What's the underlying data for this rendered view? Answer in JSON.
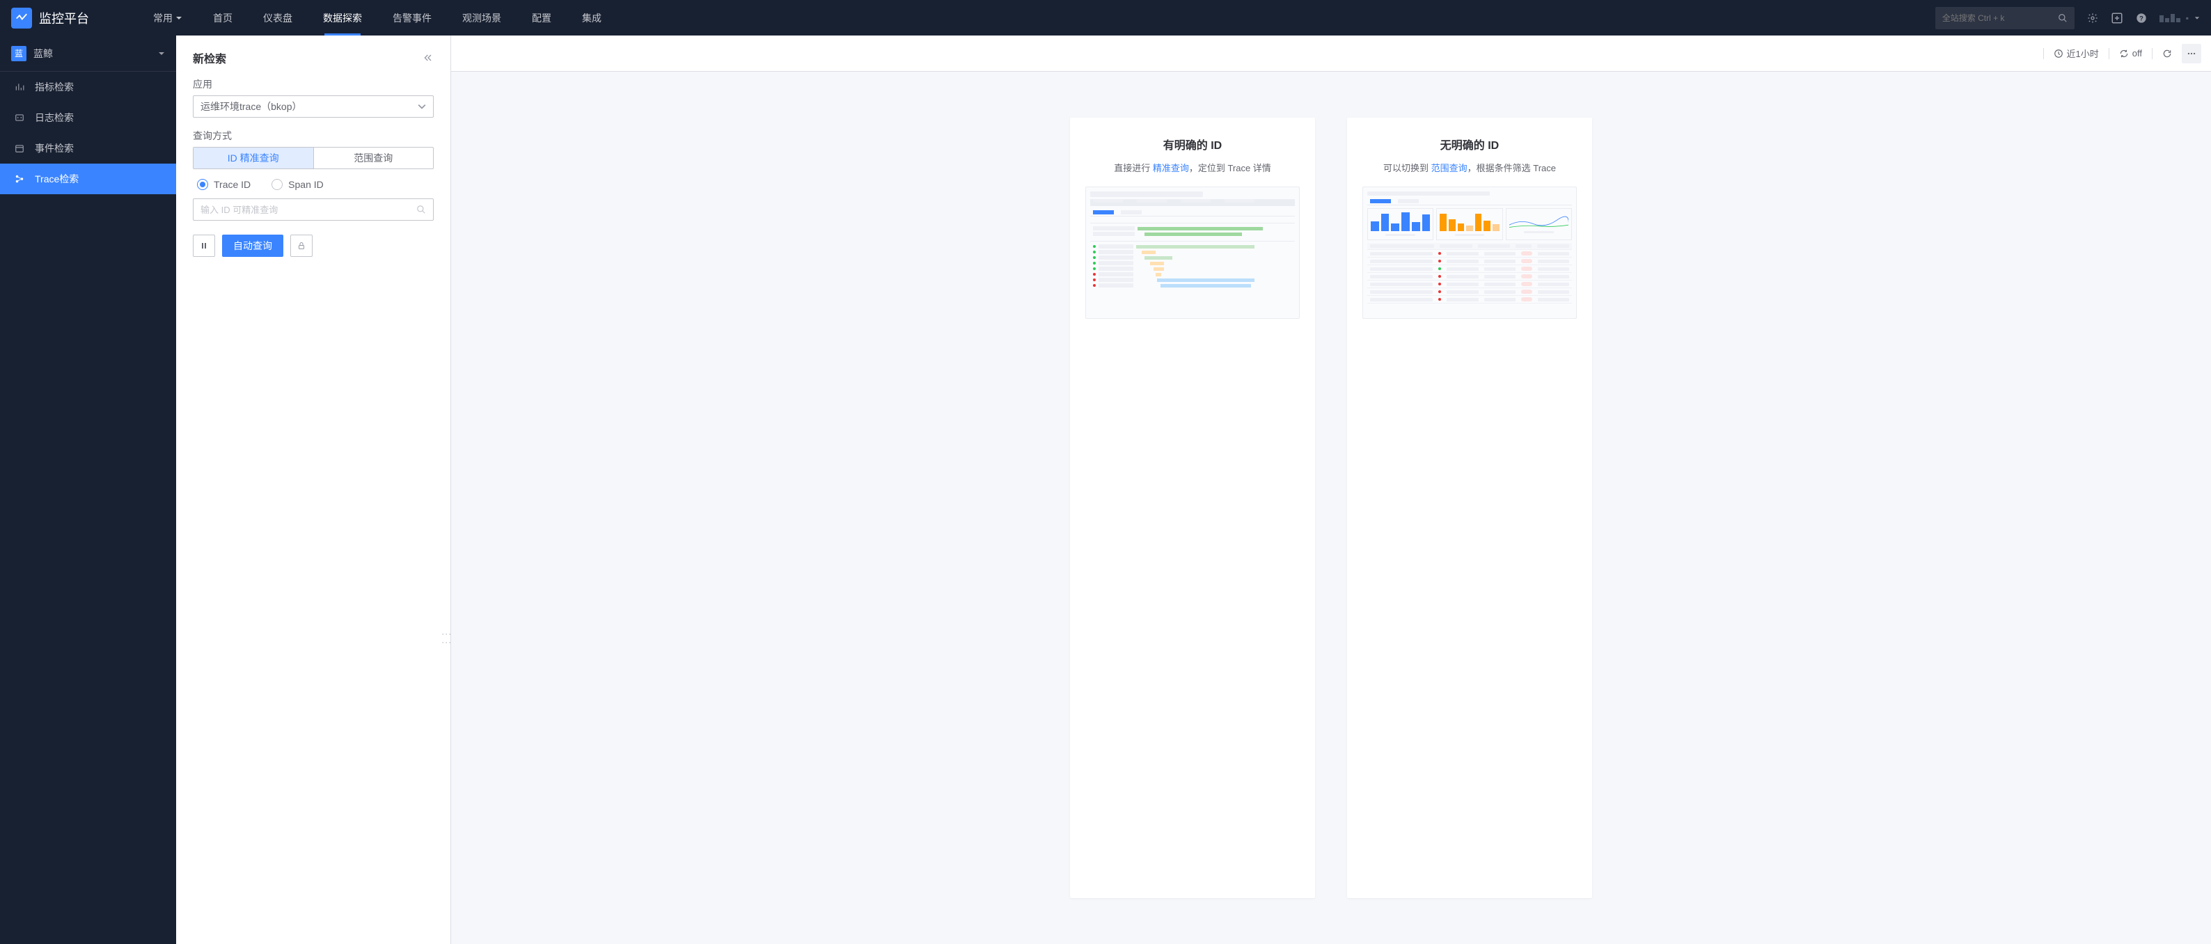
{
  "header": {
    "logo_text": "监控平台",
    "nav_dropdown": "常用",
    "nav": [
      "首页",
      "仪表盘",
      "数据探索",
      "告警事件",
      "观测场景",
      "配置",
      "集成"
    ],
    "nav_active_index": 2,
    "search_placeholder": "全站搜索 Ctrl + k"
  },
  "sidebar": {
    "biz_badge": "蓝",
    "biz_name": "蓝鲸",
    "items": [
      {
        "label": "指标检索"
      },
      {
        "label": "日志检索"
      },
      {
        "label": "事件检索"
      },
      {
        "label": "Trace检索"
      }
    ],
    "active_index": 3
  },
  "panel": {
    "title": "新检索",
    "app_label": "应用",
    "app_value": "运维环境trace（bkop）",
    "query_mode_label": "查询方式",
    "tabs": [
      "ID 精准查询",
      "范围查询"
    ],
    "tab_active_index": 0,
    "radios": [
      "Trace ID",
      "Span ID"
    ],
    "radio_checked_index": 0,
    "id_placeholder": "输入 ID 可精准查询",
    "auto_query": "自动查询"
  },
  "toolbar": {
    "time_range": "近1小时",
    "refresh_state": "off"
  },
  "cards": [
    {
      "title": "有明确的 ID",
      "desc_pre": "直接进行 ",
      "desc_link": "精准查询",
      "desc_post": "，定位到 Trace 详情"
    },
    {
      "title": "无明确的 ID",
      "desc_pre": "可以切换到 ",
      "desc_link": "范围查询",
      "desc_post": "，根据条件筛选 Trace"
    }
  ]
}
